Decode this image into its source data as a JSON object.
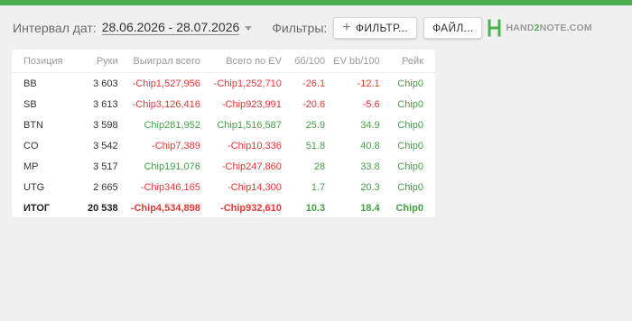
{
  "colors": {
    "accent": "#4caf50",
    "positive": "#43a047",
    "negative": "#e53935"
  },
  "toolbar": {
    "interval_label": "Интервал дат:",
    "date_range": "28.06.2026 - 28.07.2026",
    "filters_label": "Фильтры:",
    "filter_button": "ФИЛЬТР...",
    "file_button": "ФАЙЛ...",
    "logo": {
      "part1": "HAND",
      "part2": "2",
      "part3": "NOTE.COM",
      "icon": "h2n-logo-icon"
    }
  },
  "table": {
    "headers": [
      "Позиция",
      "Руки",
      "Выиграл всего",
      "Всего по EV",
      "бб/100",
      "EV bb/100",
      "Рейк"
    ],
    "rows": [
      [
        "BB",
        "3 603",
        "-Chip1,527,956",
        "-Chip1,252,710",
        "-26.1",
        "-12.1",
        "Chip0"
      ],
      [
        "SB",
        "3 613",
        "-Chip3,126,416",
        "-Chip923,991",
        "-20.6",
        "-5.6",
        "Chip0"
      ],
      [
        "BTN",
        "3 598",
        "Chip281,952",
        "Chip1,516,587",
        "25.9",
        "34.9",
        "Chip0"
      ],
      [
        "CO",
        "3 542",
        "-Chip7,389",
        "-Chip10,336",
        "51.8",
        "40.8",
        "Chip0"
      ],
      [
        "MP",
        "3 517",
        "Chip191,076",
        "-Chip247,860",
        "28",
        "33.8",
        "Chip0"
      ],
      [
        "UTG",
        "2 665",
        "-Chip346,165",
        "-Chip14,300",
        "1.7",
        "20.3",
        "Chip0"
      ]
    ],
    "total": [
      "ИТОГ",
      "20 538",
      "-Chip4,534,898",
      "-Chip932,610",
      "10.3",
      "18.4",
      "Chip0"
    ]
  }
}
